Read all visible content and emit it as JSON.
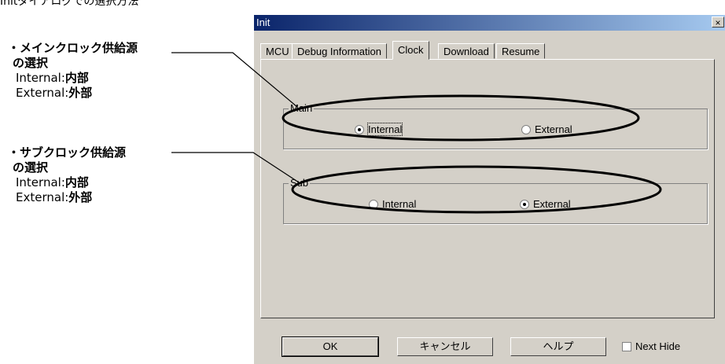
{
  "top_text": "Initダイアログでの選択方法",
  "annotations": [
    {
      "head": "・メインクロック供給源",
      "sub": "の選択",
      "internal_label": "Internal",
      "internal_value": "内部",
      "external_label": "External",
      "external_value": "外部"
    },
    {
      "head": "・サブクロック供給源",
      "sub": "の選択",
      "internal_label": "Internal",
      "internal_value": "内部",
      "external_label": "External",
      "external_value": "外部"
    }
  ],
  "dialog": {
    "title": "Init",
    "close_glyph": "×",
    "tabs": [
      "MCU",
      "Debug Information",
      "Clock",
      "Download",
      "Resume"
    ],
    "active_tab": "Clock",
    "groups": [
      {
        "legend": "Main",
        "options": [
          "Internal",
          "External"
        ],
        "selected": "Internal"
      },
      {
        "legend": "Sub",
        "options": [
          "Internal",
          "External"
        ],
        "selected": "External"
      }
    ],
    "buttons": {
      "ok": "OK",
      "cancel": "キャンセル",
      "help": "ヘルプ"
    },
    "next_hide": {
      "label": "Next Hide",
      "checked": false
    }
  },
  "colors": {
    "dialog_bg": "#d4d0c8",
    "titlebar_start": "#0a246a",
    "titlebar_end": "#a6caf0"
  }
}
